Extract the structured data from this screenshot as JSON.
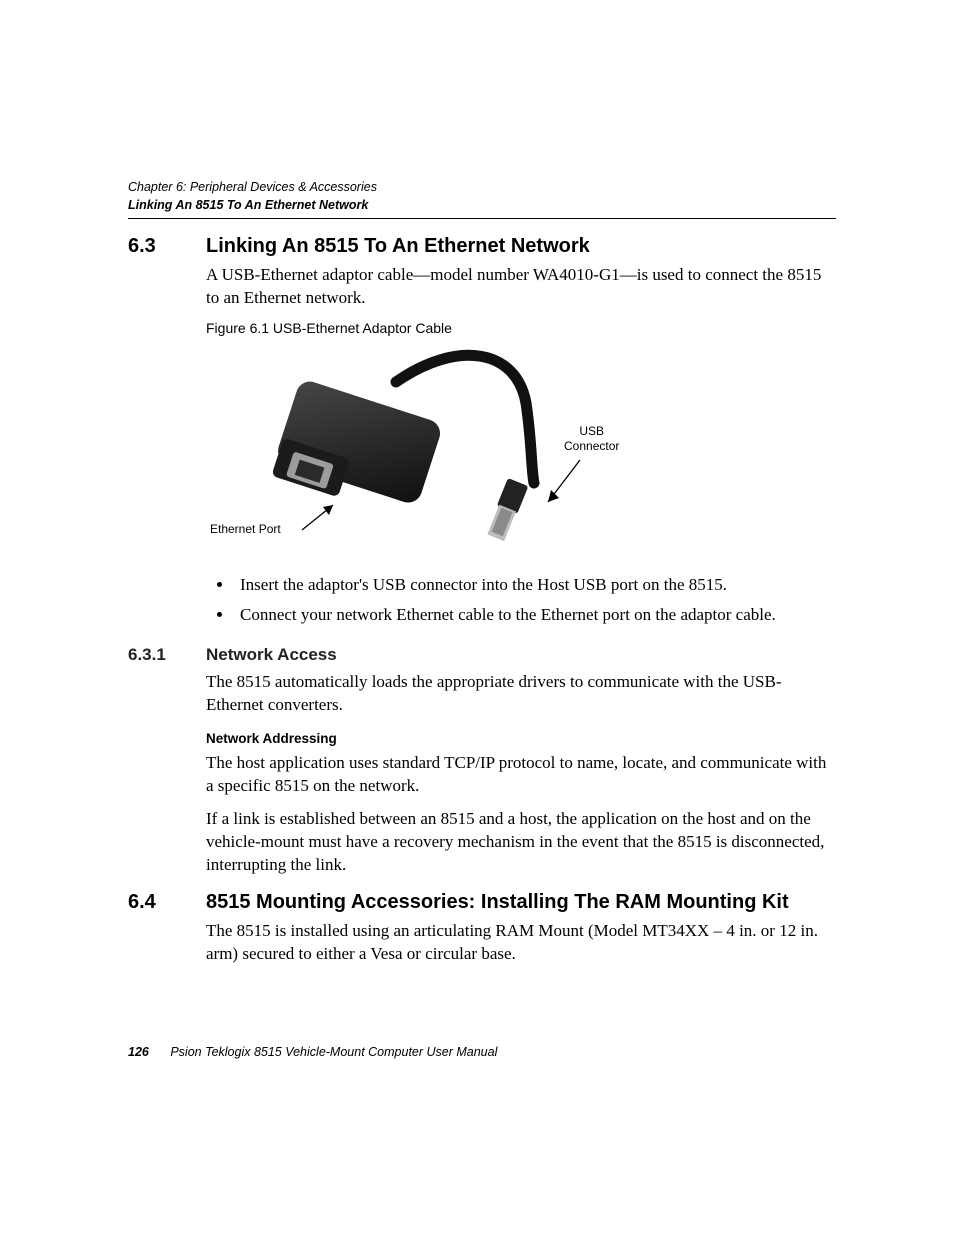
{
  "header": {
    "chapter_line": "Chapter 6: Peripheral Devices & Accessories",
    "section_line": "Linking An 8515 To An Ethernet Network"
  },
  "sec63": {
    "num": "6.3",
    "title": "Linking An 8515 To An Ethernet Network",
    "intro": "A USB-Ethernet adaptor cable—model number WA4010-G1—is used to connect the 8515 to an Ethernet network.",
    "fig_caption": "Figure 6.1  USB-Ethernet Adaptor Cable",
    "label_ethernet": "Ethernet Port",
    "label_usb_l1": "USB",
    "label_usb_l2": "Connector",
    "bullets": [
      "Insert the adaptor's USB connector into the Host USB port on the 8515.",
      "Connect your network Ethernet cable to the Ethernet port on the adaptor cable."
    ]
  },
  "sec631": {
    "num": "6.3.1",
    "title": "Network Access",
    "p1": "The 8515 automatically loads the appropriate drivers to communicate with the USB-Ethernet converters.",
    "runin": "Network Addressing",
    "p2": "The host application uses standard TCP/IP protocol to name, locate, and communicate with a specific 8515 on the network.",
    "p3": "If a link is established between an 8515 and a host, the application on the host and on the vehicle-mount must have a recovery mechanism in the event that the 8515 is disconnected, interrupting the link."
  },
  "sec64": {
    "num": "6.4",
    "title": "8515 Mounting Accessories: Installing The RAM Mounting Kit",
    "p1": "The 8515 is installed using an articulating RAM Mount (Model MT34XX – 4 in. or 12 in. arm) secured to either a Vesa or circular base."
  },
  "footer": {
    "page": "126",
    "manual": "Psion Teklogix 8515 Vehicle-Mount Computer User Manual"
  }
}
